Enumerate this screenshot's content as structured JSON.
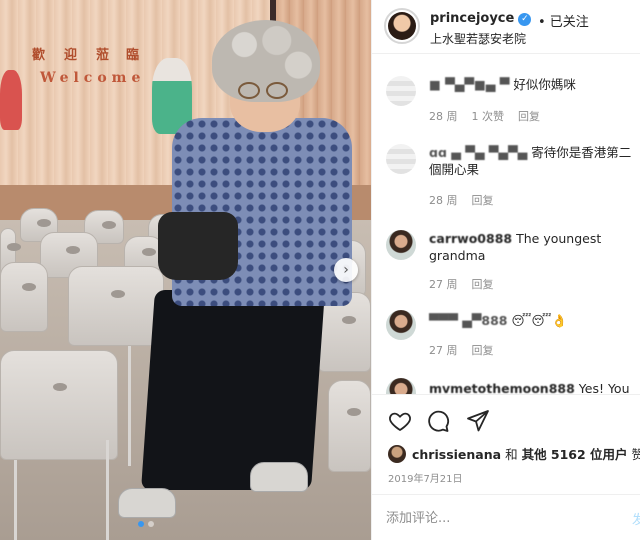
{
  "photo": {
    "banner_chars": [
      "歡",
      "迎",
      "蒞",
      "臨"
    ],
    "banner_welcome": "Welcome",
    "next_glyph": "›"
  },
  "header": {
    "username": "princejoyce",
    "verified_glyph": "✓",
    "follow_label": "• 已关注",
    "location": "上水聖若瑟安老院"
  },
  "comments": [
    {
      "user": "■ ▀▄▀■▄ ▀",
      "text": "好似你媽咪",
      "age": "28 周",
      "likes": "1 次赞",
      "reply": "回复"
    },
    {
      "user": "ɑɑ ▄ ▀▄ ▀▄▀▄",
      "text": "寄待你是香港第二個開心果",
      "age": "28 周",
      "likes": "",
      "reply": "回复"
    },
    {
      "user": "carrwo0888",
      "text": "The youngest grandma",
      "age": "27 周",
      "likes": "",
      "reply": "回复"
    },
    {
      "user": "▀▀▀ ▄▀888",
      "text": "😴😴👌",
      "age": "27 周",
      "likes": "",
      "reply": "回复"
    },
    {
      "user": "mvmetothemoon888",
      "text": "Yes! You",
      "age": "",
      "likes": "",
      "reply": ""
    }
  ],
  "actions": {
    "like_icon": "heart-icon",
    "comment_icon": "comment-icon",
    "share_icon": "share-icon"
  },
  "likes": {
    "first_user": "chrissienana",
    "connector": "和",
    "others": "其他 5162 位用户",
    "suffix": "赞了"
  },
  "date": "2019年7月21日",
  "add_comment": {
    "placeholder": "添加评论...",
    "post_label": "发"
  }
}
